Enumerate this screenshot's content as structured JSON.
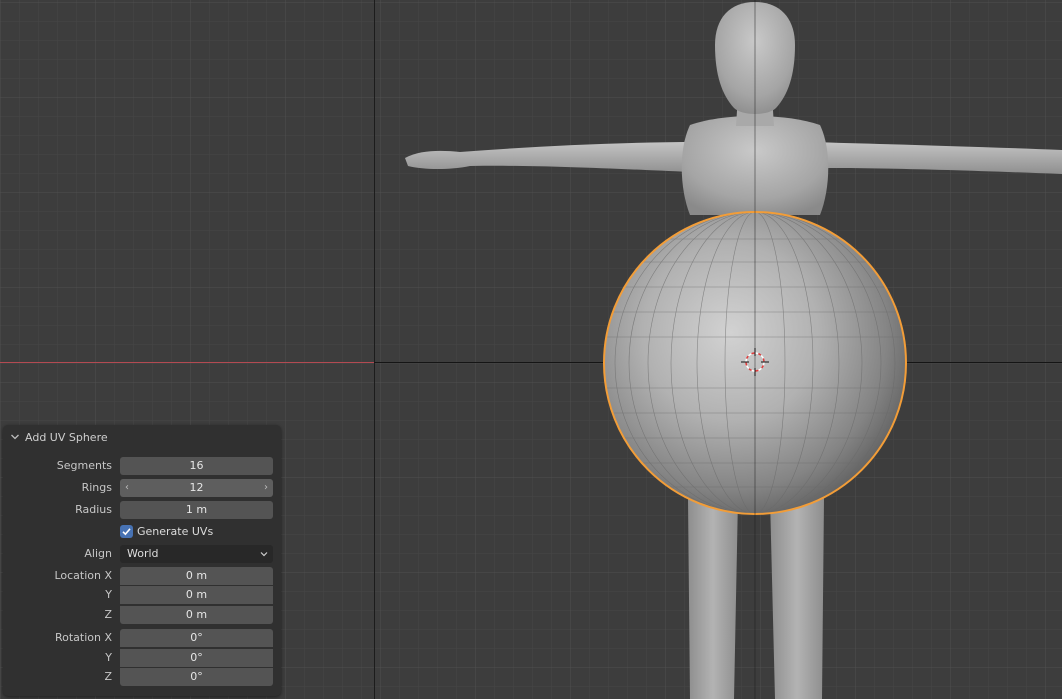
{
  "operator_panel": {
    "title": "Add UV Sphere",
    "segments": {
      "label": "Segments",
      "value": "16"
    },
    "rings": {
      "label": "Rings",
      "value": "12"
    },
    "radius": {
      "label": "Radius",
      "value": "1 m"
    },
    "generate_uvs": {
      "label": "Generate UVs",
      "checked": true
    },
    "align": {
      "label": "Align",
      "value": "World"
    },
    "location": {
      "label_x": "Location X",
      "label_y": "Y",
      "label_z": "Z",
      "x": "0 m",
      "y": "0 m",
      "z": "0 m"
    },
    "rotation": {
      "label_x": "Rotation X",
      "label_y": "Y",
      "label_z": "Z",
      "x": "0°",
      "y": "0°",
      "z": "0°"
    }
  },
  "viewport": {
    "background_color": "#3d3d3d",
    "x_axis_color": "#b44a52",
    "selection_outline_color": "#f29d38",
    "objects": [
      "humanoid-mesh",
      "uv-sphere"
    ]
  },
  "icons": {
    "collapse": "chevron-down-icon",
    "rings_left": "chevron-left-icon",
    "rings_right": "chevron-right-icon",
    "align_dropdown": "chevron-down-icon",
    "cursor": "3d-cursor-icon",
    "checkbox": "checkmark-icon"
  }
}
